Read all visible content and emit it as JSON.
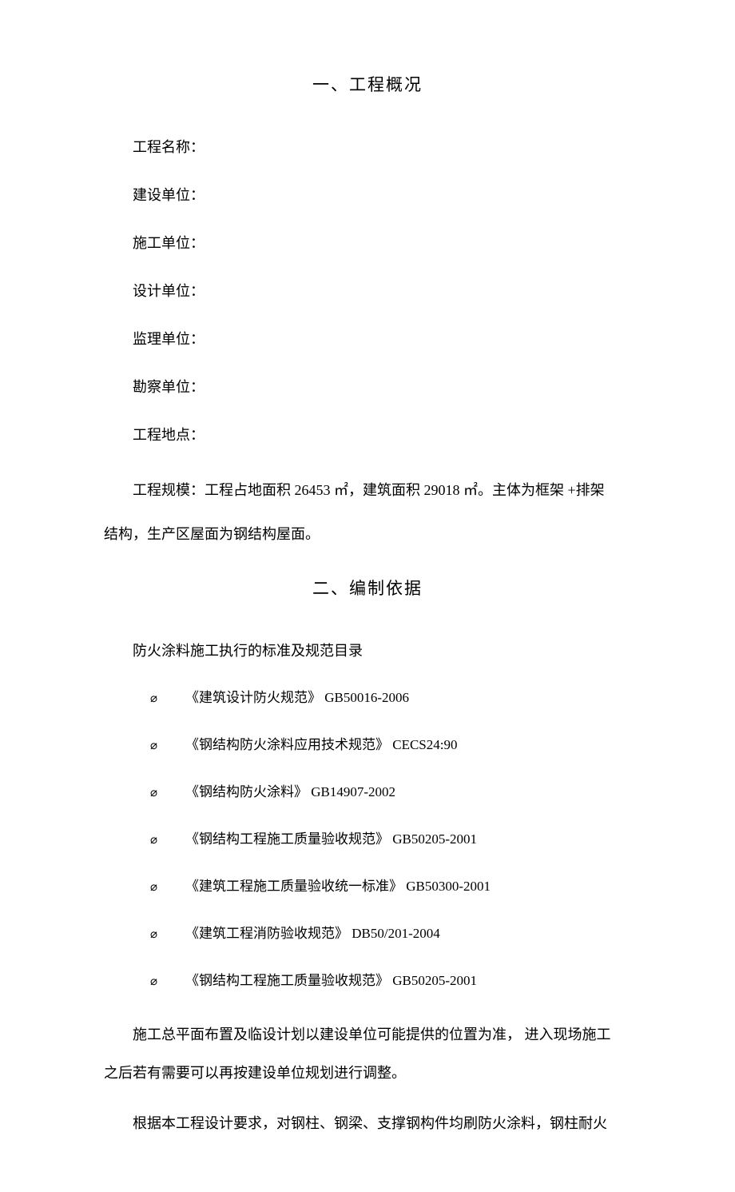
{
  "section1": {
    "title": "一、工程概况",
    "fields": {
      "project_name": "工程名称：",
      "builder": "建设单位：",
      "contractor": "施工单位：",
      "designer": "设计单位：",
      "supervisor": "监理单位：",
      "surveyor": "勘察单位：",
      "location": "工程地点："
    },
    "scale_l1": "工程规模：工程占地面积 26453 ㎡，建筑面积 29018  ㎡。主体为框架 +排架",
    "scale_l2": "结构，生产区屋面为钢结构屋面。"
  },
  "section2": {
    "title": "二、编制依据",
    "intro": "防火涂料施工执行的标准及规范目录",
    "standards": [
      "《建筑设计防火规范》 GB50016-2006",
      "《钢结构防火涂料应用技术规范》 CECS24:90",
      "《钢结构防火涂料》 GB14907-2002",
      "《钢结构工程施工质量验收规范》 GB50205-2001",
      "《建筑工程施工质量验收统一标准》 GB50300-2001",
      "《建筑工程消防验收规范》 DB50/201-2004",
      "《钢结构工程施工质量验收规范》 GB50205-2001"
    ],
    "para1_l1": "施工总平面布置及临设计划以建设单位可能提供的位置为准，  进入现场施工",
    "para1_l2": "之后若有需要可以再按建设单位规划进行调整。",
    "para2": "根据本工程设计要求，对钢柱、钢梁、支撑钢构件均刷防火涂料，钢柱耐火"
  }
}
